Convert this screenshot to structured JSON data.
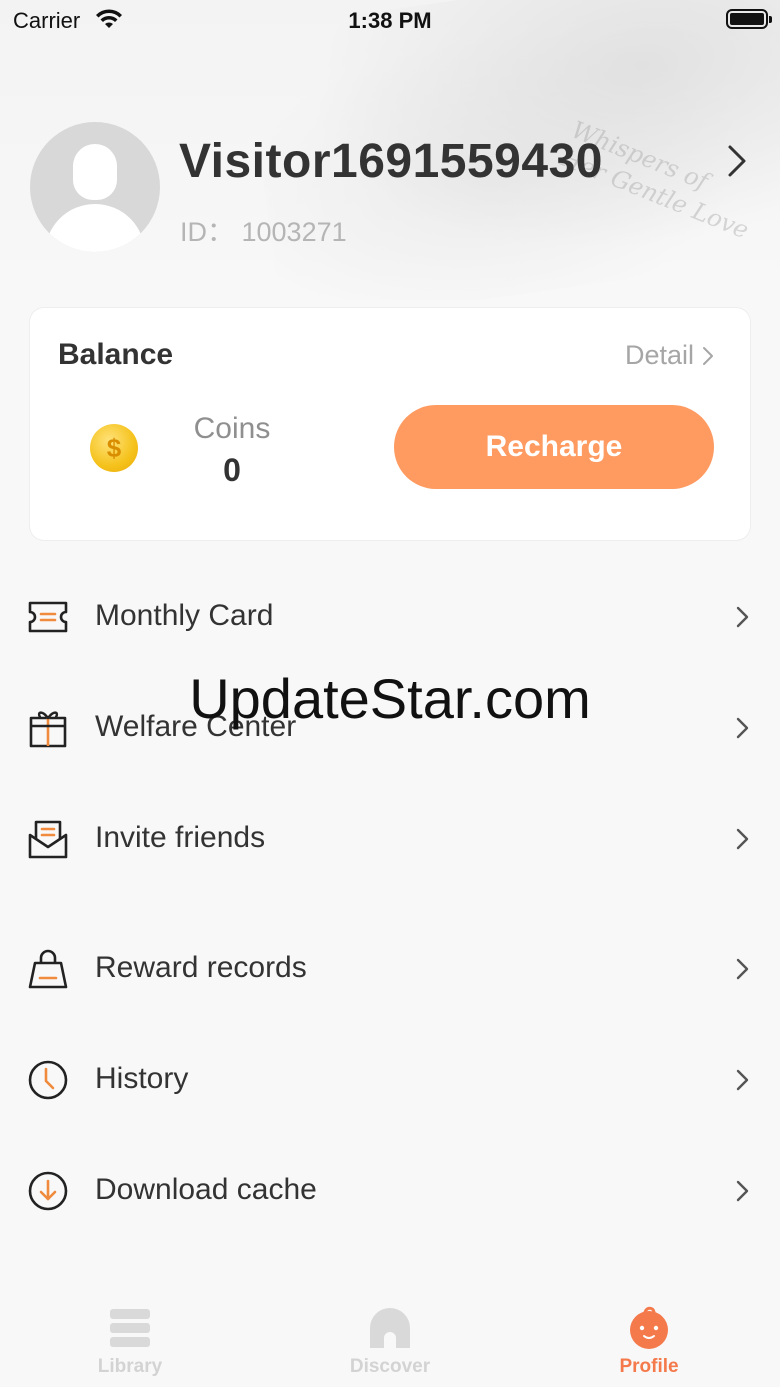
{
  "status_bar": {
    "carrier": "Carrier",
    "time": "1:38 PM"
  },
  "hero": {
    "art_text": "Whispers of\nHer Gentle Love"
  },
  "profile": {
    "username": "Visitor1691559430",
    "id_text": "ID： 1003271"
  },
  "balance": {
    "title": "Balance",
    "detail_label": "Detail",
    "coins_label": "Coins",
    "coins_value": "0",
    "recharge_label": "Recharge"
  },
  "menu": {
    "items": [
      {
        "label": "Monthly Card",
        "icon": "ticket-icon"
      },
      {
        "label": "Welfare Center",
        "icon": "gift-icon"
      },
      {
        "label": "Invite friends",
        "icon": "envelope-icon"
      },
      {
        "label": "Reward records",
        "icon": "shopping-bag-icon"
      },
      {
        "label": "History",
        "icon": "clock-icon"
      },
      {
        "label": "Download cache",
        "icon": "download-icon"
      }
    ]
  },
  "watermark": "UpdateStar.com",
  "tabs": [
    {
      "label": "Library",
      "icon": "library-icon",
      "active": false
    },
    {
      "label": "Discover",
      "icon": "discover-icon",
      "active": false
    },
    {
      "label": "Profile",
      "icon": "profile-icon",
      "active": true
    }
  ],
  "colors": {
    "accent": "#ff9a61",
    "accent_dark": "#f47a4c",
    "icon_orange": "#f08a3c"
  }
}
